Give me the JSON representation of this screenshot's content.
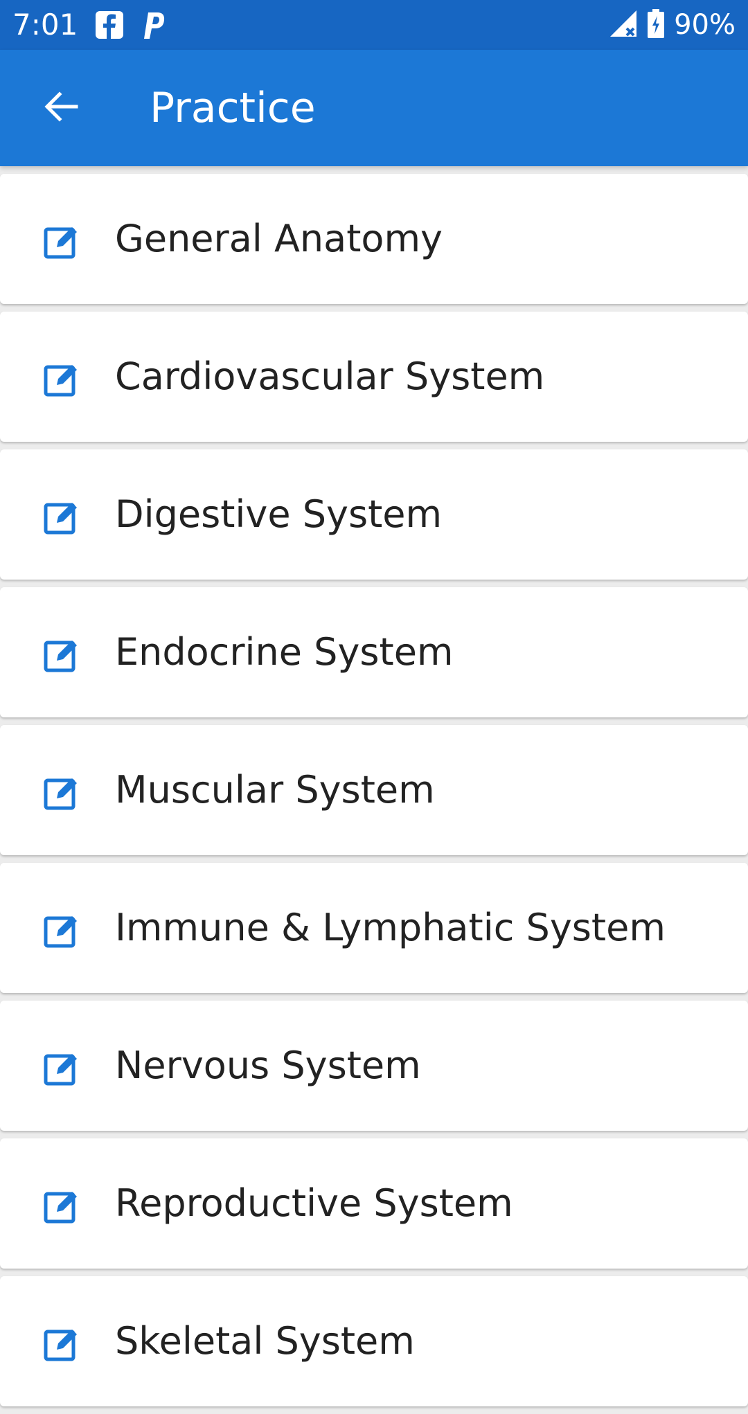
{
  "status_bar": {
    "time": "7:01",
    "notification_icons": [
      "facebook-icon",
      "pandora-icon"
    ],
    "signal_icon": "signal-no-data-icon",
    "battery_icon": "battery-charging-icon",
    "battery_percent": "90%"
  },
  "app_bar": {
    "back_icon": "arrow-left-icon",
    "title": "Practice"
  },
  "colors": {
    "status_bar": "#1766c2",
    "app_bar": "#1c78d6",
    "icon_accent": "#1c78d6",
    "text": "#222222",
    "background": "#ececec"
  },
  "list": {
    "item_icon": "edit-icon",
    "items": [
      {
        "label": "General Anatomy"
      },
      {
        "label": "Cardiovascular System"
      },
      {
        "label": "Digestive System"
      },
      {
        "label": "Endocrine System"
      },
      {
        "label": "Muscular System"
      },
      {
        "label": "Immune & Lymphatic System"
      },
      {
        "label": "Nervous System"
      },
      {
        "label": "Reproductive System"
      },
      {
        "label": "Skeletal System"
      }
    ]
  }
}
